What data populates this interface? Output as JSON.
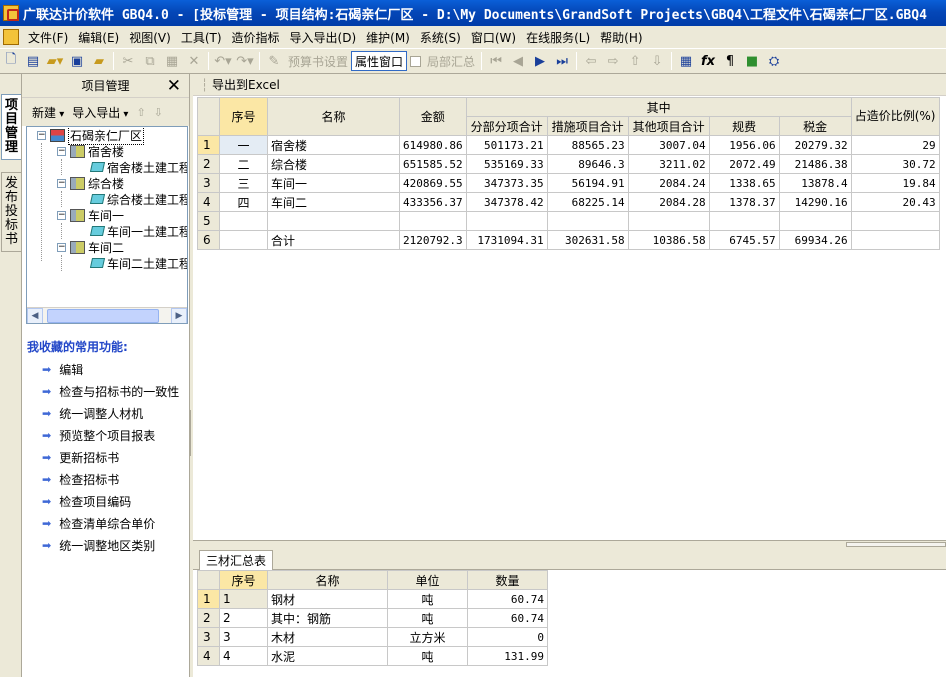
{
  "window": {
    "title": "广联达计价软件 GBQ4.0 - [投标管理 - 项目结构:石碣亲仁厂区 - D:\\My Documents\\GrandSoft Projects\\GBQ4\\工程文件\\石碣亲仁厂区.GBQ4"
  },
  "menu": [
    "文件(F)",
    "编辑(E)",
    "视图(V)",
    "工具(T)",
    "造价指标",
    "导入导出(D)",
    "维护(M)",
    "系统(S)",
    "窗口(W)",
    "在线服务(L)",
    "帮助(H)"
  ],
  "toolbar": {
    "budget_settings": "预算书设置",
    "property_window": "属性窗口",
    "partial_summary": "局部汇总"
  },
  "vtabs": [
    "项目管理",
    "发布投标书"
  ],
  "left_panel": {
    "title": "项目管理",
    "new_label": "新建",
    "import_export_label": "导入导出",
    "tree": [
      {
        "label": "石碣亲仁厂区",
        "level": 0,
        "icon": "project-icon",
        "expander": "−"
      },
      {
        "label": "宿舍楼",
        "level": 1,
        "icon": "building-icon",
        "expander": "−"
      },
      {
        "label": "宿舍楼土建工程",
        "level": 2,
        "icon": "unit-project-icon"
      },
      {
        "label": "综合楼",
        "level": 1,
        "icon": "building-icon",
        "expander": "−"
      },
      {
        "label": "综合楼土建工程",
        "level": 2,
        "icon": "unit-project-icon"
      },
      {
        "label": "车间一",
        "level": 1,
        "icon": "building-icon",
        "expander": "−"
      },
      {
        "label": "车间一土建工程",
        "level": 2,
        "icon": "unit-project-icon"
      },
      {
        "label": "车间二",
        "level": 1,
        "icon": "building-icon",
        "expander": "−"
      },
      {
        "label": "车间二土建工程",
        "level": 2,
        "icon": "unit-project-icon"
      }
    ],
    "favorites_title": "我收藏的常用功能:",
    "favorites": [
      "编辑",
      "检查与招标书的一致性",
      "统一调整人材机",
      "预览整个项目报表",
      "更新招标书",
      "检查招标书",
      "检查项目编码",
      "检查清单综合单价",
      "统一调整地区类别"
    ]
  },
  "main": {
    "export_label": "导出到Excel",
    "summary_table": {
      "headers": {
        "seq": "序号",
        "name": "名称",
        "amount": "金额",
        "group": "其中",
        "sub": [
          "分部分项合计",
          "措施项目合计",
          "其他项目合计",
          "规费",
          "税金"
        ],
        "ratio": "占造价比例(%)"
      },
      "rows": [
        {
          "rn": "1",
          "seq": "一",
          "name": "宿舍楼",
          "amount": "614980.86",
          "fb": "501173.21",
          "cs": "88565.23",
          "qt": "3007.04",
          "gf": "1956.06",
          "sj": "20279.32",
          "ratio": "29"
        },
        {
          "rn": "2",
          "seq": "二",
          "name": "综合楼",
          "amount": "651585.52",
          "fb": "535169.33",
          "cs": "89646.3",
          "qt": "3211.02",
          "gf": "2072.49",
          "sj": "21486.38",
          "ratio": "30.72"
        },
        {
          "rn": "3",
          "seq": "三",
          "name": "车间一",
          "amount": "420869.55",
          "fb": "347373.35",
          "cs": "56194.91",
          "qt": "2084.24",
          "gf": "1338.65",
          "sj": "13878.4",
          "ratio": "19.84"
        },
        {
          "rn": "4",
          "seq": "四",
          "name": "车间二",
          "amount": "433356.37",
          "fb": "347378.42",
          "cs": "68225.14",
          "qt": "2084.28",
          "gf": "1378.37",
          "sj": "14290.16",
          "ratio": "20.43"
        },
        {
          "rn": "5",
          "seq": "",
          "name": "",
          "amount": "",
          "fb": "",
          "cs": "",
          "qt": "",
          "gf": "",
          "sj": "",
          "ratio": ""
        },
        {
          "rn": "6",
          "seq": "",
          "name": "合计",
          "amount": "2120792.3",
          "fb": "1731094.31",
          "cs": "302631.58",
          "qt": "10386.58",
          "gf": "6745.57",
          "sj": "69934.26",
          "ratio": ""
        }
      ]
    },
    "materials_tab": "三材汇总表",
    "materials_table": {
      "headers": [
        "序号",
        "名称",
        "单位",
        "数量"
      ],
      "rows": [
        {
          "rn": "1",
          "seq": "1",
          "name": "钢材",
          "unit": "吨",
          "qty": "60.74"
        },
        {
          "rn": "2",
          "seq": "2",
          "name": "其中：钢筋",
          "unit": "吨",
          "qty": "60.74"
        },
        {
          "rn": "3",
          "seq": "3",
          "name": "木材",
          "unit": "立方米",
          "qty": "0"
        },
        {
          "rn": "4",
          "seq": "4",
          "name": "水泥",
          "unit": "吨",
          "qty": "131.99"
        }
      ]
    }
  }
}
